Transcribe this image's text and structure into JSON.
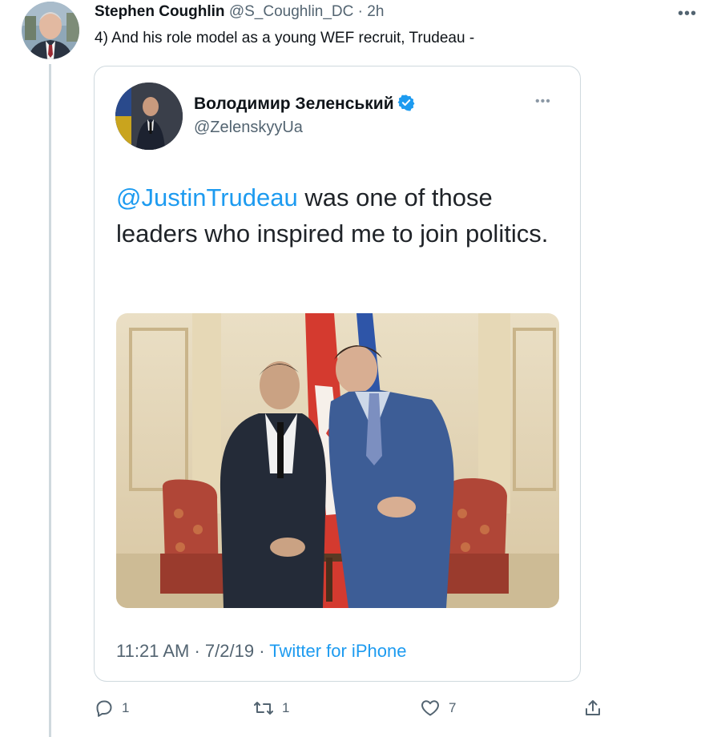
{
  "tweet": {
    "author_name": "Stephen Coughlin",
    "author_handle": "@S_Coughlin_DC",
    "separator": "·",
    "time": "2h",
    "text": "4) And his role model as a young WEF recruit, Trudeau -",
    "more_icon": "ellipsis-icon"
  },
  "quoted": {
    "name": "Володимир Зеленський",
    "handle": "@ZelenskyyUa",
    "mention": "@JustinTrudeau",
    "text": " was one of those leaders who inspired me to join politics.",
    "time": "11:21 AM",
    "date": "7/2/19",
    "separator": "·",
    "source": "Twitter for iPhone",
    "verified_color": "#1d9bf0"
  },
  "actions": {
    "replies": "1",
    "retweets": "1",
    "likes": "7"
  },
  "colors": {
    "link": "#1d9bf0",
    "muted": "#536471",
    "border": "#cfd9de"
  }
}
